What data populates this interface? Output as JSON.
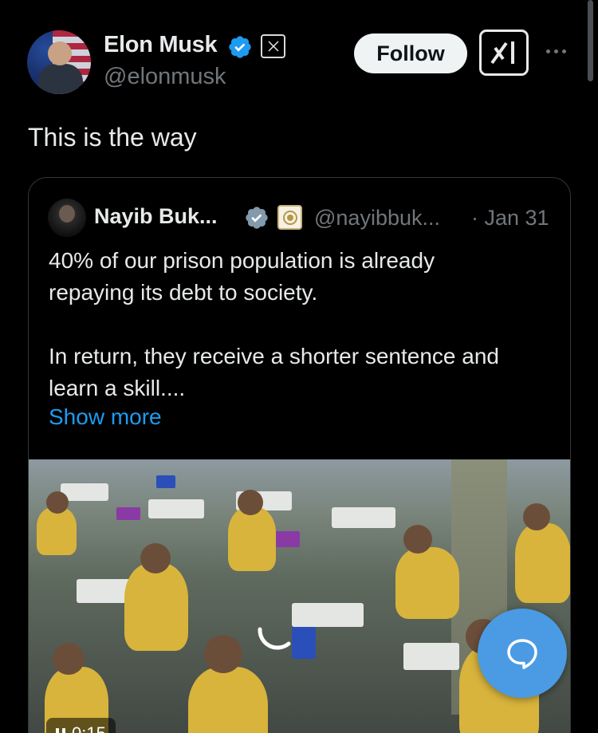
{
  "author": {
    "name": "Elon Musk",
    "handle": "@elonmusk",
    "verified_color": "#1d9bf0"
  },
  "actions": {
    "follow_label": "Follow"
  },
  "tweet": {
    "text": "This is the way"
  },
  "quoted_tweet": {
    "name": "Nayib Buk...",
    "handle": "@nayibbuk...",
    "date": "· Jan 31",
    "text_lines_1": [
      "40% of our prison population is already",
      "repaying its debt to society."
    ],
    "text_lines_2": [
      "In return, they receive a shorter sentence and",
      "learn a skill...."
    ],
    "show_more": "Show more",
    "video": {
      "time": "0:15",
      "state": "playing"
    }
  },
  "icons": {
    "verified": "verified-check-icon",
    "affiliation": "x-affiliate-badge-icon",
    "grok": "grok-icon",
    "more": "more-dots-icon",
    "reply": "reply-bubble-icon",
    "loading": "spinner-icon",
    "pause": "pause-icon"
  },
  "colors": {
    "accent": "#1d9bf0",
    "background": "#000000",
    "secondary_text": "#71767b",
    "fab": "#4a9be3"
  }
}
